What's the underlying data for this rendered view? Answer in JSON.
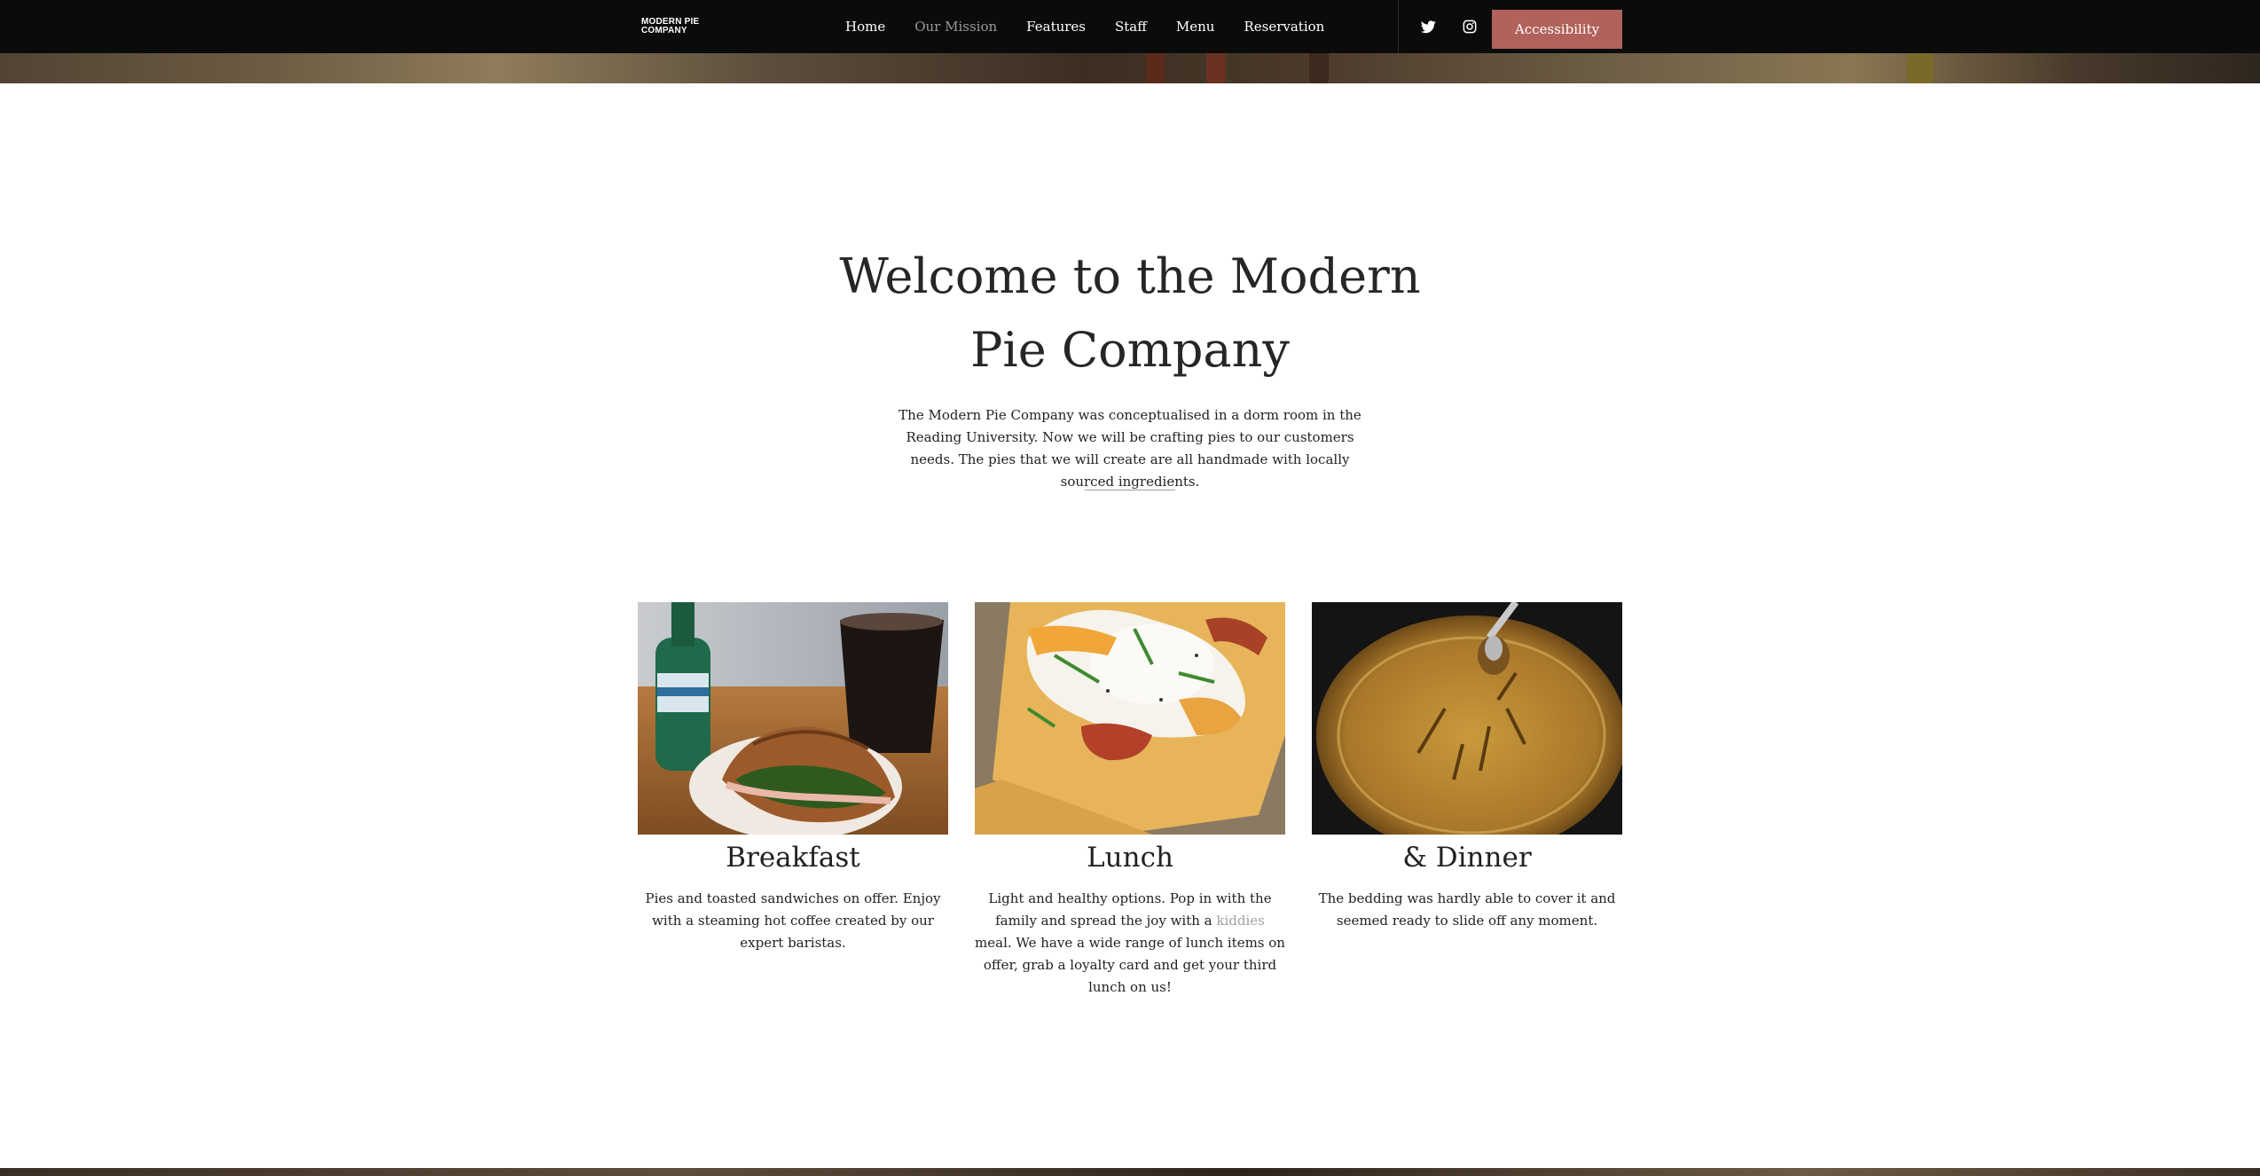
{
  "header": {
    "logo_line1": "MODERN PIE",
    "logo_line2": "COMPANY",
    "nav": [
      {
        "label": "Home"
      },
      {
        "label": "Our Mission"
      },
      {
        "label": "Features"
      },
      {
        "label": "Staff"
      },
      {
        "label": "Menu"
      },
      {
        "label": "Reservation"
      }
    ],
    "active_nav": "Our Mission",
    "social_icons": [
      "twitter-icon",
      "instagram-icon"
    ],
    "accessibility_label": "Accessibility"
  },
  "intro": {
    "title_line1": "Welcome to the Modern",
    "title_line2": "Pie Company",
    "text": "The Modern Pie Company was conceptualised in a dorm room in the Reading University. Now we will be crafting pies to our customers needs. The pies that we will create are all handmade with locally sourced ingredients."
  },
  "cards": [
    {
      "title": "Breakfast",
      "text": "Pies and toasted sandwiches on offer. Enjoy with a steaming hot coffee created by our expert baristas."
    },
    {
      "title": "Lunch",
      "text_before": "Light and healthy options. Pop in with the family and spread the joy with a ",
      "link": "kiddies",
      "text_after": " meal. We have a wide range of lunch items on offer, grab a loyalty card and get your third lunch on us!"
    },
    {
      "title": "& Dinner",
      "text": "The bedding was hardly able to cover it and seemed ready to slide off any moment."
    }
  ],
  "colors": {
    "nav_background": "#0b0b0b",
    "accent_button": "#b1625a",
    "active_nav_text": "#9a9a9a",
    "link_gray": "#a2a2a2"
  }
}
